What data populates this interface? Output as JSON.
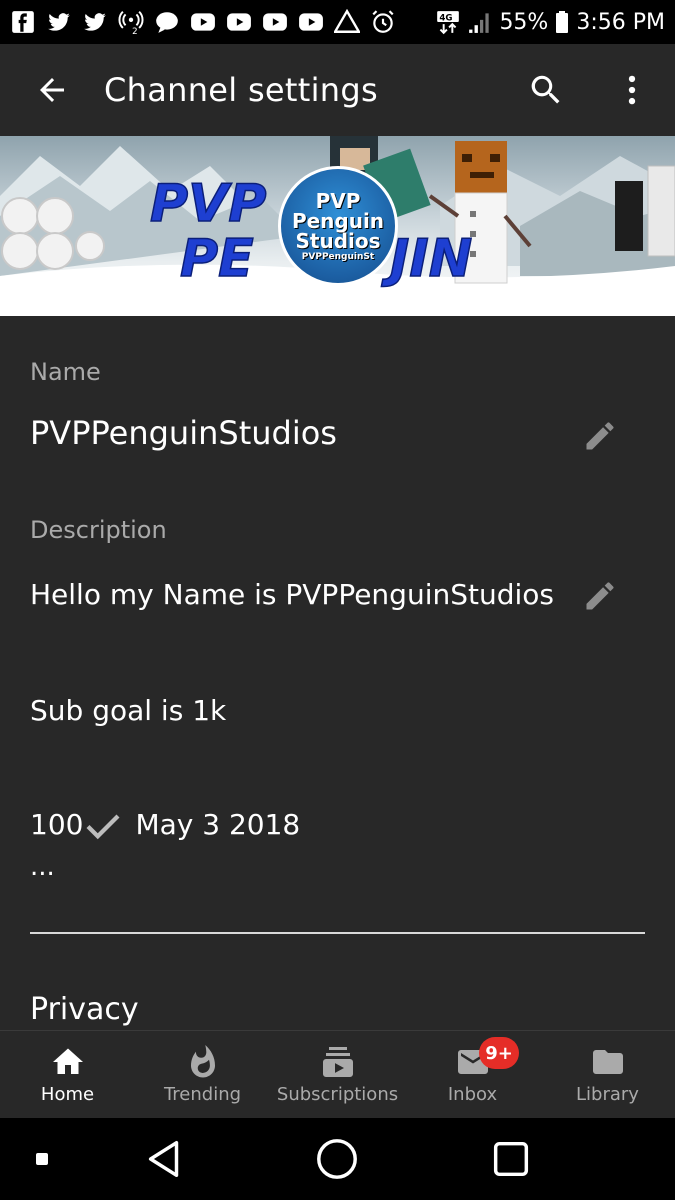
{
  "status_bar": {
    "battery_percent": "55%",
    "time": "3:56 PM",
    "network": "4G",
    "icons": [
      "facebook-icon",
      "twitter-icon",
      "twitter-icon",
      "hotspot-icon",
      "chat-icon",
      "youtube-icon",
      "youtube-icon",
      "youtube-icon",
      "youtube-icon",
      "warning-icon",
      "alarm-icon",
      "network-4g-icon",
      "signal-icon",
      "battery-icon"
    ]
  },
  "app_bar": {
    "title": "Channel settings",
    "back_icon": "arrow-left-icon",
    "search_icon": "search-icon",
    "more_icon": "more-vert-icon"
  },
  "banner": {
    "logo_line1": "PVP",
    "logo_line2": "Penguin",
    "logo_line3": "Studios",
    "logo_small": "PVPPenguinSt",
    "banner_text_a": "PVP",
    "banner_text_b": "PE",
    "banner_text_c": "JIN"
  },
  "settings": {
    "name_label": "Name",
    "name_value": "PVPPenguinStudios",
    "description_label": "Description",
    "description_line1": "Hello my Name is PVPPenguinStudios",
    "description_line2": "Sub goal is 1k",
    "description_line3_count": "100",
    "description_line3_date": "May 3 2018",
    "description_more": "...",
    "privacy_label": "Privacy"
  },
  "bottom_nav": {
    "items": [
      {
        "label": "Home",
        "icon": "home-icon",
        "active": true
      },
      {
        "label": "Trending",
        "icon": "flame-icon",
        "active": false
      },
      {
        "label": "Subscriptions",
        "icon": "subscriptions-icon",
        "active": false
      },
      {
        "label": "Inbox",
        "icon": "mail-icon",
        "active": false,
        "badge": "9+"
      },
      {
        "label": "Library",
        "icon": "folder-icon",
        "active": false
      }
    ]
  },
  "colors": {
    "background": "#282828",
    "label": "#aaaaaa",
    "inactive_nav": "#aaaaaa",
    "badge": "#e52d27"
  }
}
